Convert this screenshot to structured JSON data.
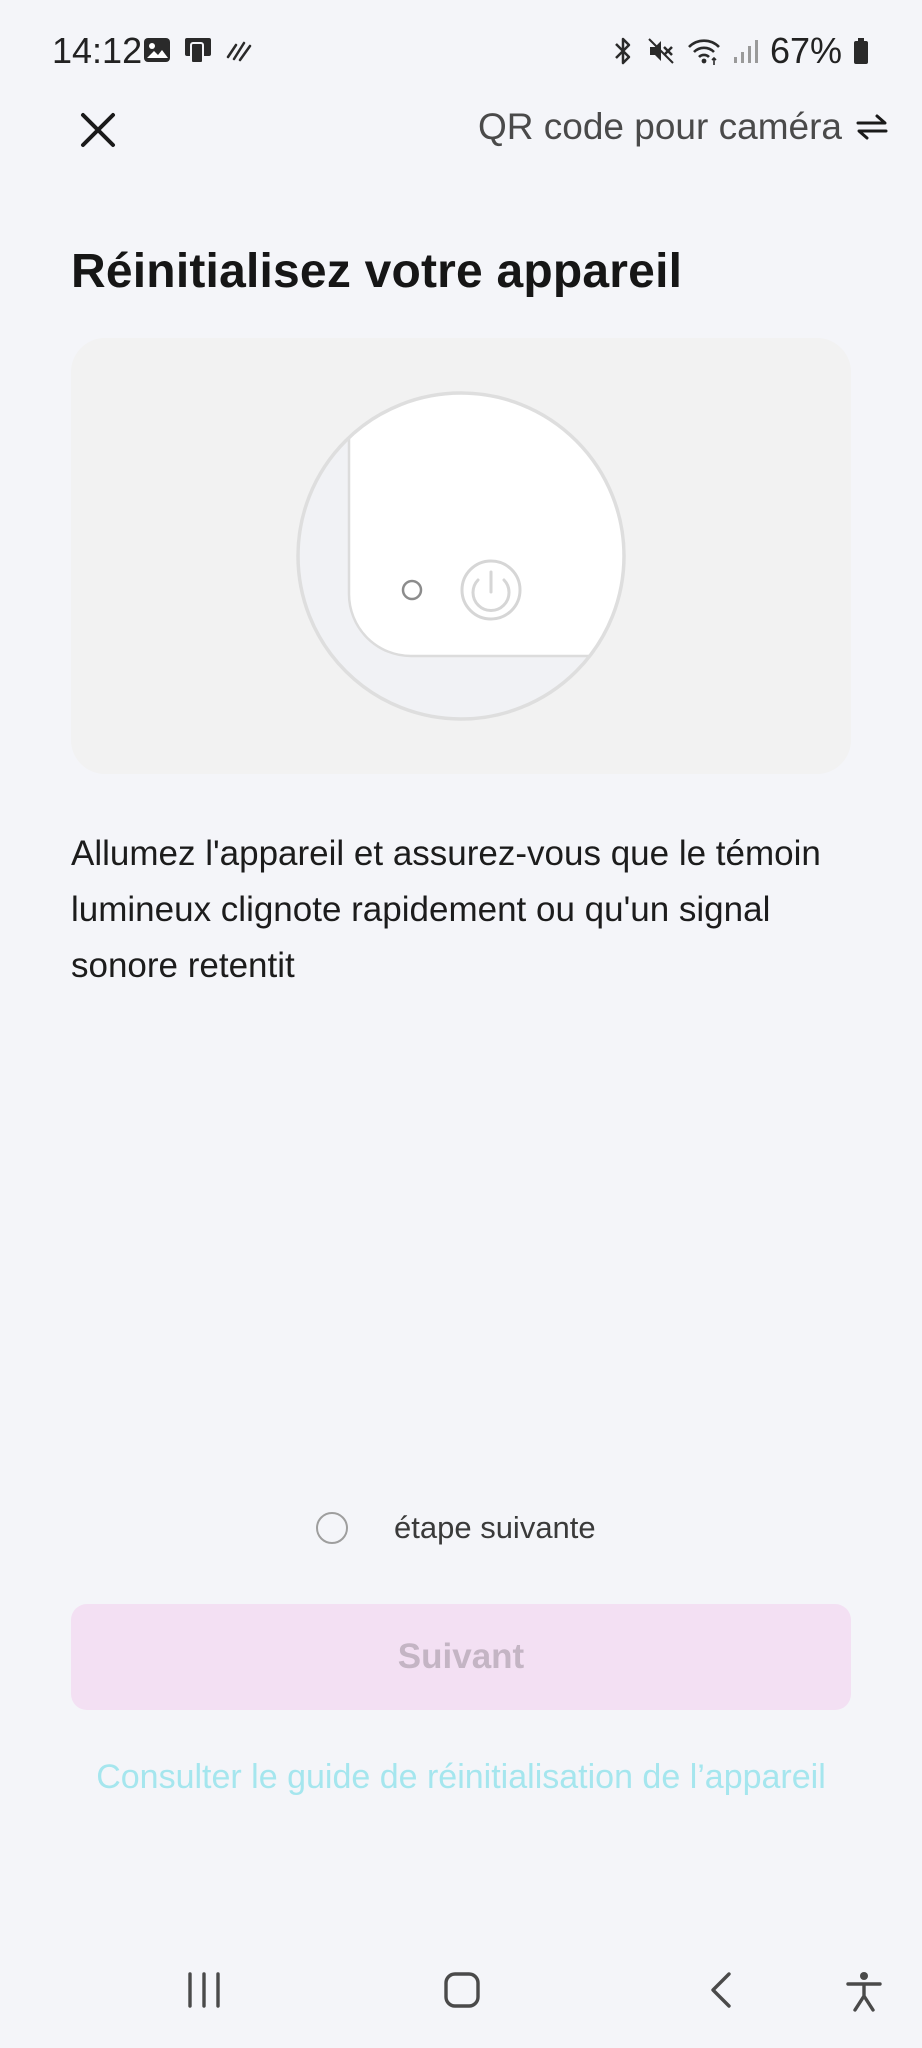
{
  "status_bar": {
    "time": "14:12",
    "battery": "67%",
    "left_icons": [
      "gallery-icon",
      "screen-mirror-icon",
      "nfc-icon"
    ],
    "right_icons": [
      "bluetooth-icon",
      "mute-icon",
      "wifi-icon",
      "signal-icon",
      "battery-icon"
    ]
  },
  "header": {
    "close_icon": "close-icon",
    "switch_label": "QR code pour caméra",
    "switch_icon": "swap-arrows-icon"
  },
  "main": {
    "title": "Réinitialisez votre appareil",
    "illustration_icon": "device-reset-illustration",
    "instructions": "Allumez l'appareil et assurez-vous que le témoin lumineux clignote rapidement ou qu'un signal sonore retentit"
  },
  "confirm": {
    "label": "étape suivante",
    "checked": false
  },
  "actions": {
    "next_label": "Suivant",
    "next_enabled": false,
    "guide_link": "Consulter le guide de réinitialisation de l’appareil"
  },
  "colors": {
    "background": "#f4f5f9",
    "button_disabled_bg": "#f3e0f3",
    "button_disabled_text": "#c4b5c4",
    "link": "#a5e6ee"
  },
  "nav_bar": {
    "items": [
      "recent-apps-icon",
      "home-icon",
      "back-icon",
      "accessibility-icon"
    ]
  }
}
